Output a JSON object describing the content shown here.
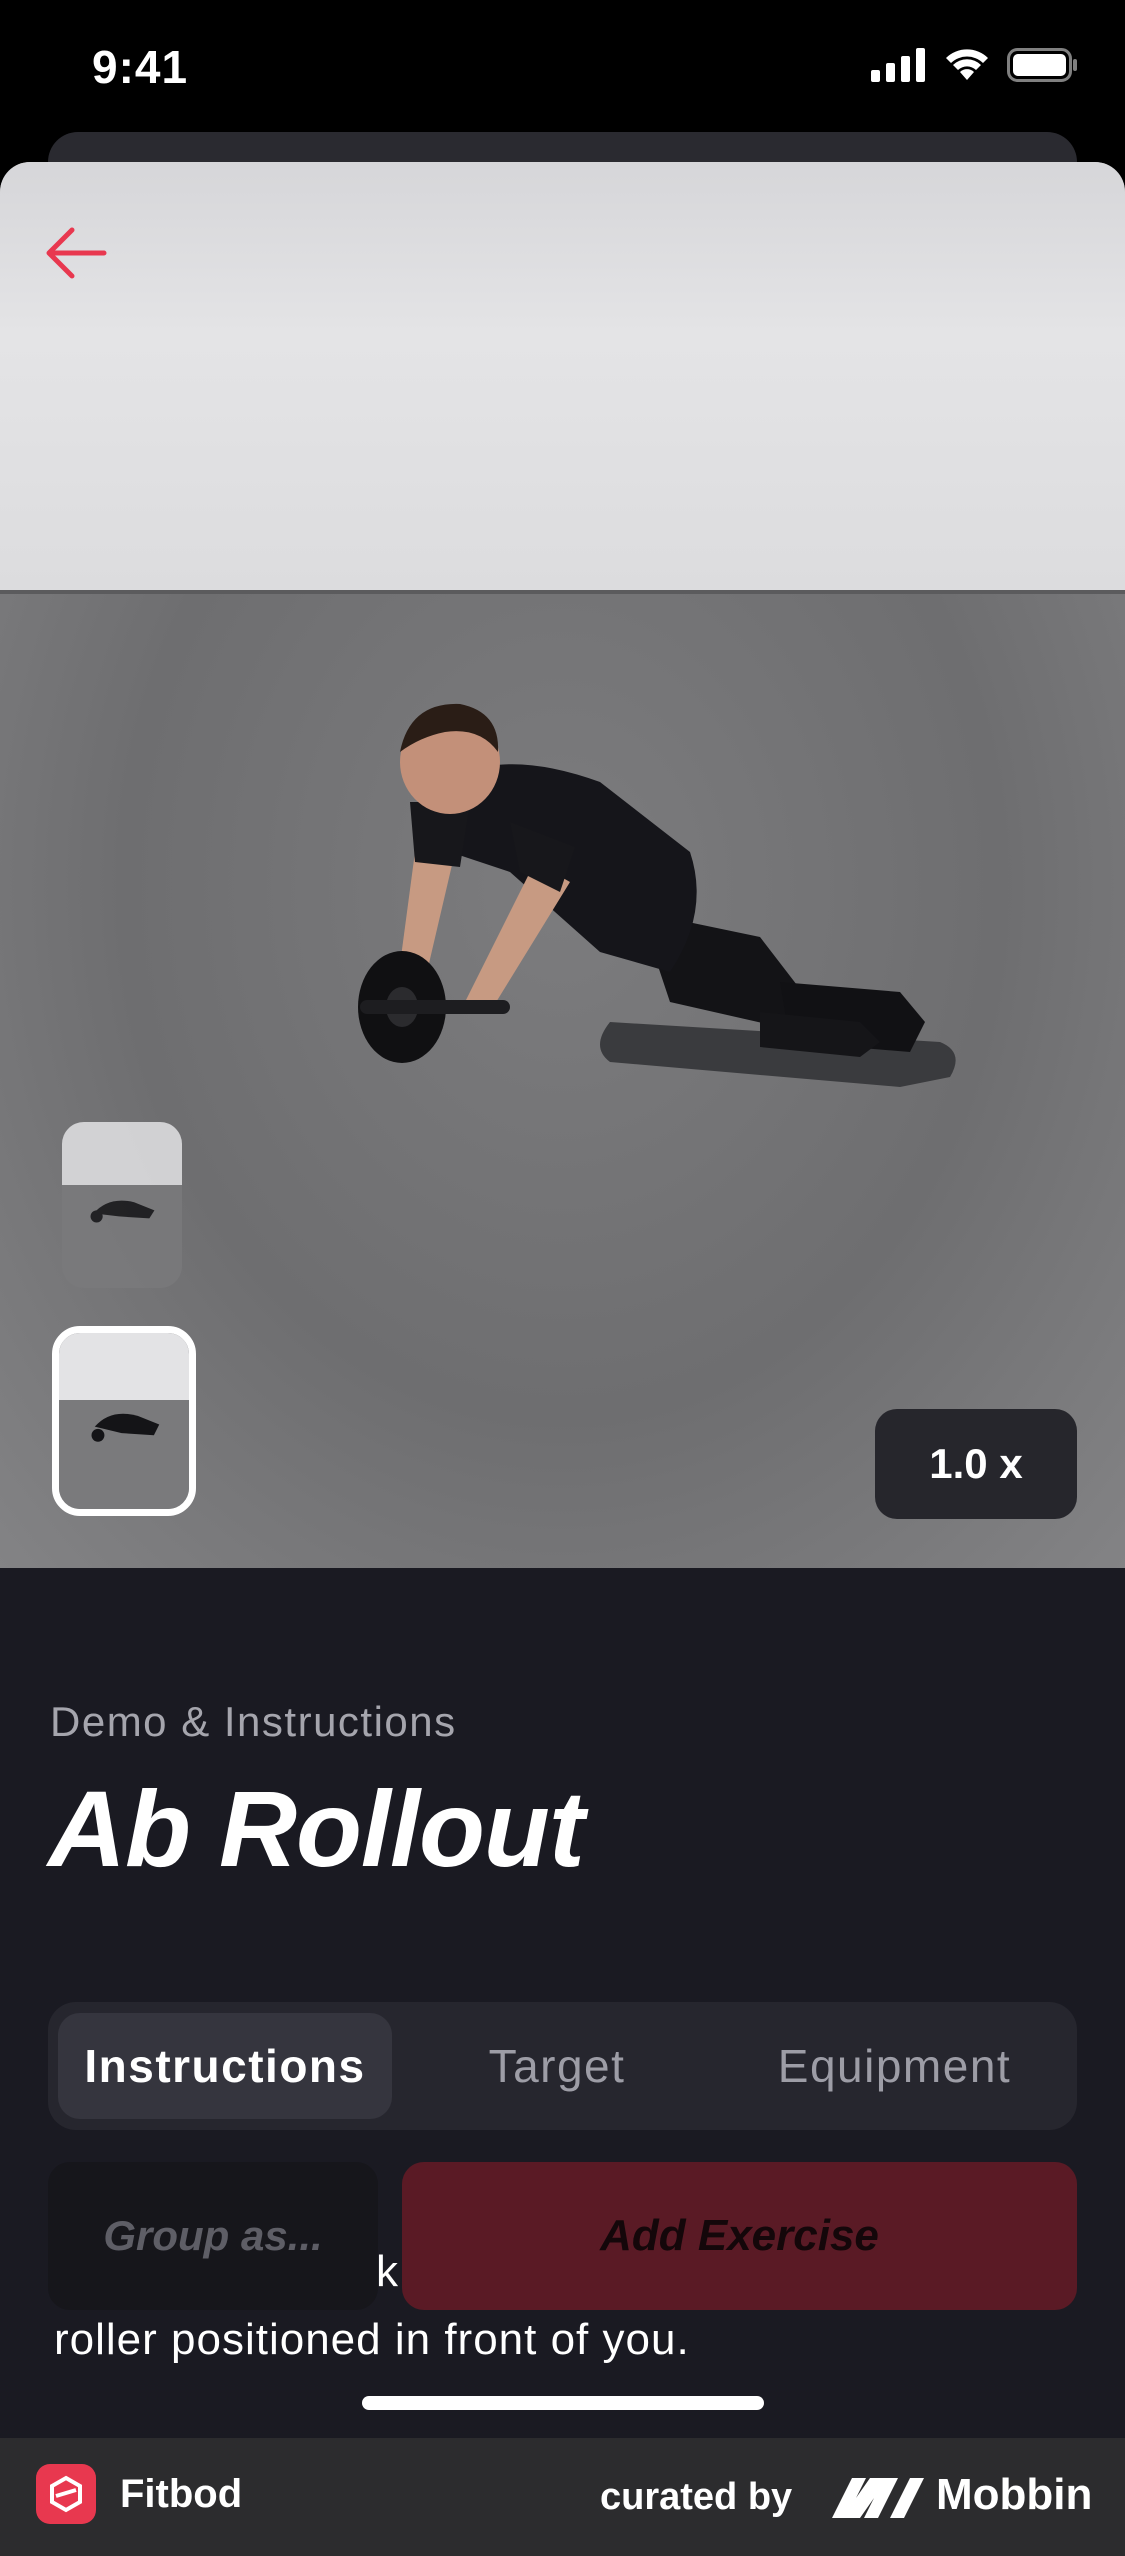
{
  "status_bar": {
    "time": "9:41"
  },
  "media": {
    "playback_speed": "1.0 x"
  },
  "content": {
    "subtitle": "Demo & Instructions",
    "title": "Ab Rollout",
    "tabs": [
      {
        "label": "Instructions",
        "active": true
      },
      {
        "label": "Target",
        "active": false
      },
      {
        "label": "Equipment",
        "active": false
      }
    ],
    "instruction_line_1": "k",
    "instruction_line_2": "roller positioned in front of you.",
    "group_button": "Group as...",
    "add_button": "Add Exercise"
  },
  "attribution": {
    "app_name": "Fitbod",
    "curated_by": "curated by",
    "brand": "Mobbin"
  },
  "colors": {
    "accent": "#e8384f",
    "panel_bg": "#1a1a22",
    "add_button_bg": "#5a1a25"
  },
  "icons": [
    "back-arrow-icon",
    "signal-icon",
    "wifi-icon",
    "battery-icon",
    "fitbod-logo-icon",
    "mobbin-logo-icon"
  ]
}
